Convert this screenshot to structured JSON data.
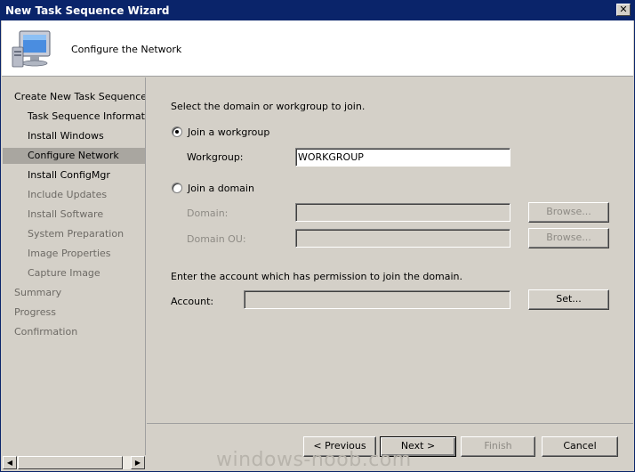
{
  "window": {
    "title": "New Task Sequence Wizard"
  },
  "header": {
    "title": "Configure the Network",
    "icon": "computer-monitor-icon"
  },
  "nav": {
    "items": [
      {
        "label": "Create New Task Sequence",
        "level": "top",
        "state": "normal"
      },
      {
        "label": "Task Sequence Information",
        "level": "sub",
        "state": "normal"
      },
      {
        "label": "Install Windows",
        "level": "sub",
        "state": "normal"
      },
      {
        "label": "Configure Network",
        "level": "sub",
        "state": "selected"
      },
      {
        "label": "Install ConfigMgr",
        "level": "sub",
        "state": "normal"
      },
      {
        "label": "Include Updates",
        "level": "sub",
        "state": "disabled"
      },
      {
        "label": "Install Software",
        "level": "sub",
        "state": "disabled"
      },
      {
        "label": "System Preparation",
        "level": "sub",
        "state": "disabled"
      },
      {
        "label": "Image Properties",
        "level": "sub",
        "state": "disabled"
      },
      {
        "label": "Capture Image",
        "level": "sub",
        "state": "disabled"
      },
      {
        "label": "Summary",
        "level": "top",
        "state": "disabled"
      },
      {
        "label": "Progress",
        "level": "top",
        "state": "disabled"
      },
      {
        "label": "Confirmation",
        "level": "top",
        "state": "disabled"
      }
    ]
  },
  "main": {
    "instruction": "Select the domain or workgroup to join.",
    "workgroup_radio": "Join a workgroup",
    "workgroup_label": "Workgroup:",
    "workgroup_value": "WORKGROUP",
    "domain_radio": "Join a domain",
    "domain_label": "Domain:",
    "domain_value": "",
    "domain_ou_label": "Domain OU:",
    "domain_ou_value": "",
    "browse_label": "Browse...",
    "account_instruction": "Enter the account which has permission to join the domain.",
    "account_label": "Account:",
    "account_value": "",
    "set_label": "Set..."
  },
  "footer": {
    "previous_label": "< Previous",
    "next_label": "Next >",
    "finish_label": "Finish",
    "cancel_label": "Cancel"
  },
  "watermark": "windows-noob.com"
}
